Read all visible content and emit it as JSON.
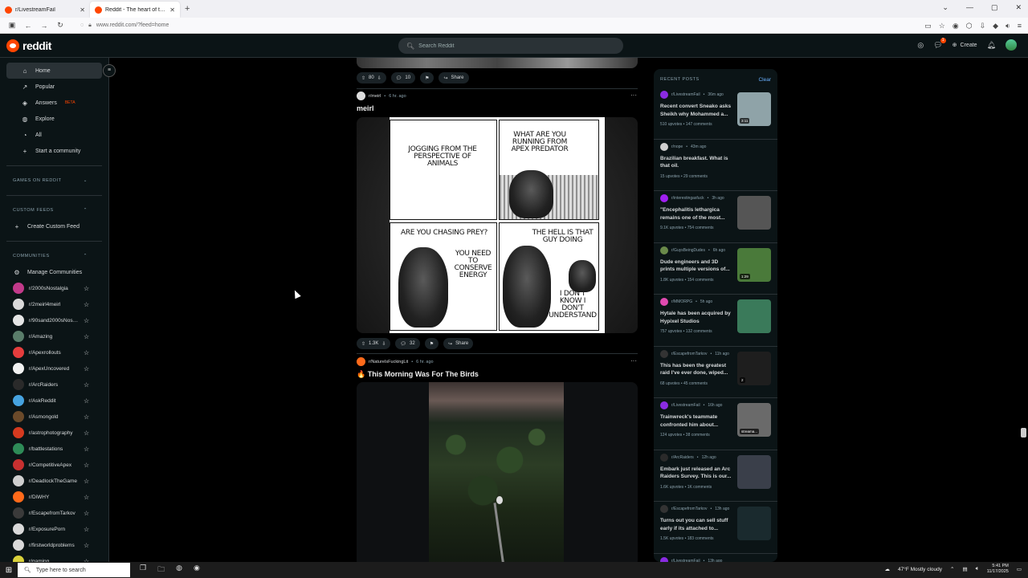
{
  "browser": {
    "tabs": [
      {
        "label": "r/LivestreamFail",
        "close": "✕"
      },
      {
        "label": "Reddit - The heart of the internet",
        "close": "✕"
      }
    ],
    "new_tab": "+",
    "url": "www.reddit.com/?feed=home"
  },
  "header": {
    "logo_text": "reddit",
    "search_placeholder": "Search Reddit",
    "create_label": "Create",
    "chat_badge": "1"
  },
  "sidebar": {
    "nav": [
      {
        "label": "Home",
        "icon": "home-icon"
      },
      {
        "label": "Popular",
        "icon": "popular-icon"
      },
      {
        "label": "Answers",
        "icon": "answers-icon",
        "badge": "BETA"
      },
      {
        "label": "Explore",
        "icon": "explore-icon"
      },
      {
        "label": "All",
        "icon": "all-icon"
      },
      {
        "label": "Start a community",
        "icon": "plus-icon"
      }
    ],
    "games_heading": "GAMES ON REDDIT",
    "custom_feeds_heading": "CUSTOM FEEDS",
    "create_custom_feed": "Create Custom Feed",
    "communities_heading": "COMMUNITIES",
    "manage_communities": "Manage Communities",
    "communities": [
      {
        "name": "r/2000sNostalgia",
        "color": "#c23a8a"
      },
      {
        "name": "r/2meirl4meirl",
        "color": "#d9d9d9"
      },
      {
        "name": "r/90sand2000sNostalgia",
        "color": "#e5e5e5"
      },
      {
        "name": "r/Amazing",
        "color": "#5a7d6a"
      },
      {
        "name": "r/Apexrollouts",
        "color": "#e63d3d"
      },
      {
        "name": "r/ApexUncovered",
        "color": "#f2f2f2"
      },
      {
        "name": "r/ArcRaiders",
        "color": "#2a2a2a"
      },
      {
        "name": "r/AskReddit",
        "color": "#46a3e0"
      },
      {
        "name": "r/Asmongold",
        "color": "#6b4a2a"
      },
      {
        "name": "r/astrophotography",
        "color": "#d63a1f"
      },
      {
        "name": "r/battlestations",
        "color": "#2e8b57"
      },
      {
        "name": "r/CompetitiveApex",
        "color": "#c73030"
      },
      {
        "name": "r/DeadlockTheGame",
        "color": "#cfcfcf"
      },
      {
        "name": "r/DiWHY",
        "color": "#ff6a1a"
      },
      {
        "name": "r/EscapefromTarkov",
        "color": "#3a3a3a"
      },
      {
        "name": "r/ExposurePorn",
        "color": "#d9d9d9"
      },
      {
        "name": "r/firstworldproblems",
        "color": "#d9d9d9"
      },
      {
        "name": "r/gaming",
        "color": "#d9d13a"
      }
    ]
  },
  "feed": {
    "top_actions": {
      "votes": "80",
      "comments": "10",
      "share": "Share"
    },
    "post1": {
      "subreddit": "r/meirl",
      "time": "6 hr. ago",
      "title": "meirl",
      "comic": {
        "p1": "JOGGING FROM THE PERSPECTIVE OF ANIMALS",
        "p2": "WHAT ARE YOU RUNNING FROM APEX PREDATOR",
        "p3a": "ARE YOU CHASING PREY?",
        "p3b": "YOU NEED TO CONSERVE ENERGY",
        "p4a": "THE HELL IS THAT GUY DOING",
        "p4b": "I DON'T KNOW I DON'T UNDERSTAND"
      },
      "votes": "1.3K",
      "comments": "32",
      "share": "Share"
    },
    "post2": {
      "subreddit": "r/NatureIsFuckingLit",
      "time": "6 hr. ago",
      "title": "🔥 This Morning Was For The Birds"
    }
  },
  "recent": {
    "heading": "RECENT POSTS",
    "clear": "Clear",
    "items": [
      {
        "sub": "r/LivestreamFail",
        "time": "36m ago",
        "title": "Recent convert Sneako asks Sheikh why Mohammed a...",
        "upvotes": "510 upvotes",
        "comments": "147 comments",
        "thumb": "#8fa3a8",
        "dur": "3:11",
        "avcolor": "#8a2be2"
      },
      {
        "sub": "r/nope",
        "time": "43m ago",
        "title": "Brazilian breakfast. What is that oil.",
        "upvotes": "15 upvotes",
        "comments": "29 comments",
        "thumb": "",
        "dur": "",
        "avcolor": "#cfcfcf"
      },
      {
        "sub": "r/interestingasfuck",
        "time": "3h ago",
        "title": "\"Encephalitis lethargica remains one of the most...",
        "upvotes": "9.1K upvotes",
        "comments": "754 comments",
        "thumb": "#555",
        "dur": "",
        "avcolor": "#a020f0"
      },
      {
        "sub": "r/GuysBeingDudes",
        "time": "6h ago",
        "title": "Dude engineers and 3D prints multiple versions of...",
        "upvotes": "1.8K upvotes",
        "comments": "154 comments",
        "thumb": "#4a7a3a",
        "dur": "1:29",
        "avcolor": "#6a8a4a"
      },
      {
        "sub": "r/MMORPG",
        "time": "5h ago",
        "title": "Hytale has been acquired by Hypixel Studios",
        "upvotes": "757 upvotes",
        "comments": "132 comments",
        "thumb": "#3a7a5a",
        "dur": "",
        "avcolor": "#e04ab0"
      },
      {
        "sub": "r/EscapefromTarkov",
        "time": "11h ago",
        "title": "This has been the greatest raid I've ever done, wiped...",
        "upvotes": "68 upvotes",
        "comments": "45 comments",
        "thumb": "#1e1e1e",
        "dur": "2",
        "avcolor": "#333"
      },
      {
        "sub": "r/LivestreamFail",
        "time": "16h ago",
        "title": "Trainwreck's teammate confronted him about...",
        "upvotes": "124 upvotes",
        "comments": "38 comments",
        "thumb": "#6a6a6a",
        "dur": "streama...",
        "avcolor": "#8a2be2"
      },
      {
        "sub": "r/ArcRaiders",
        "time": "12h ago",
        "title": "Embark just released an Arc Raiders Survey. This is our...",
        "upvotes": "1.6K upvotes",
        "comments": "1K comments",
        "thumb": "#3a3f4a",
        "dur": "",
        "avcolor": "#2a2a2a"
      },
      {
        "sub": "r/EscapefromTarkov",
        "time": "13h ago",
        "title": "Turns out you can sell stuff early if its attached to...",
        "upvotes": "1.5K upvotes",
        "comments": "183 comments",
        "thumb": "#1a2a2e",
        "dur": "",
        "avcolor": "#333"
      },
      {
        "sub": "r/LivestreamFail",
        "time": "13h ago",
        "title": "",
        "upvotes": "",
        "comments": "",
        "thumb": "",
        "dur": "",
        "avcolor": "#8a2be2"
      }
    ]
  },
  "taskbar": {
    "search_placeholder": "Type here to search",
    "weather": "47°F  Mostly cloudy",
    "time": "5:41 PM",
    "date": "11/17/2025"
  }
}
